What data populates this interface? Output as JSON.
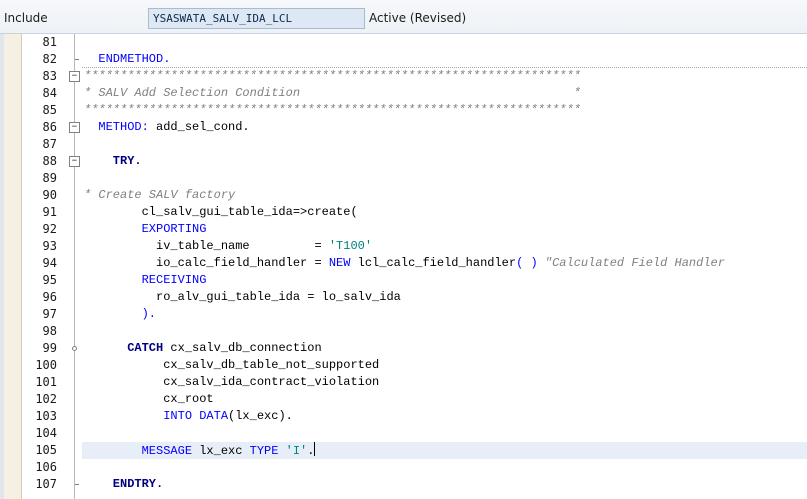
{
  "header": {
    "include_label": "Include",
    "program_name": "YSASWATA_SALV_IDA_LCL",
    "status": "Active (Revised)"
  },
  "colors": {
    "keyword": "#0000ff",
    "comment": "#808080",
    "string": "#008080",
    "current_line": "#e8eef7"
  },
  "lines": [
    {
      "num": "81",
      "marker": "",
      "tokens": []
    },
    {
      "num": "82",
      "marker": "tick",
      "tokens": [
        {
          "t": "  ENDMETHOD.",
          "c": "kw"
        }
      ]
    },
    {
      "num": "83",
      "marker": "fold",
      "tokens": [
        {
          "t": "*********************************************************************",
          "c": "cm"
        }
      ]
    },
    {
      "num": "84",
      "marker": "",
      "tokens": [
        {
          "t": "* SALV Add Selection Condition                                      *",
          "c": "cm"
        }
      ]
    },
    {
      "num": "85",
      "marker": "",
      "tokens": [
        {
          "t": "*********************************************************************",
          "c": "cm"
        }
      ]
    },
    {
      "num": "86",
      "marker": "fold",
      "tokens": [
        {
          "t": "  METHOD:",
          "c": "kw"
        },
        {
          "t": " add_sel_cond.",
          "c": "plain"
        }
      ]
    },
    {
      "num": "87",
      "marker": "",
      "tokens": []
    },
    {
      "num": "88",
      "marker": "fold",
      "tokens": [
        {
          "t": "    TRY.",
          "c": "kwb"
        }
      ]
    },
    {
      "num": "89",
      "marker": "",
      "tokens": []
    },
    {
      "num": "90",
      "marker": "",
      "tokens": [
        {
          "t": "* Create SALV factory",
          "c": "cm"
        }
      ]
    },
    {
      "num": "91",
      "marker": "",
      "tokens": [
        {
          "t": "        cl_salv_gui_table_ida=>create(",
          "c": "plain"
        }
      ]
    },
    {
      "num": "92",
      "marker": "",
      "tokens": [
        {
          "t": "        EXPORTING",
          "c": "kw"
        }
      ]
    },
    {
      "num": "93",
      "marker": "",
      "tokens": [
        {
          "t": "          iv_table_name         = ",
          "c": "plain"
        },
        {
          "t": "'T100'",
          "c": "str"
        }
      ]
    },
    {
      "num": "94",
      "marker": "",
      "tokens": [
        {
          "t": "          io_calc_field_handler = ",
          "c": "plain"
        },
        {
          "t": "NEW",
          "c": "kw"
        },
        {
          "t": " lcl_calc_field_handler",
          "c": "plain"
        },
        {
          "t": "( )",
          "c": "kw"
        },
        {
          "t": " \"Calculated Field Handler",
          "c": "cm"
        }
      ]
    },
    {
      "num": "95",
      "marker": "",
      "tokens": [
        {
          "t": "        RECEIVING",
          "c": "kw"
        }
      ]
    },
    {
      "num": "96",
      "marker": "",
      "tokens": [
        {
          "t": "          ro_alv_gui_table_ida = lo_salv_ida",
          "c": "plain"
        }
      ]
    },
    {
      "num": "97",
      "marker": "",
      "tokens": [
        {
          "t": "        ).",
          "c": "kw"
        }
      ]
    },
    {
      "num": "98",
      "marker": "",
      "tokens": []
    },
    {
      "num": "99",
      "marker": "dot",
      "tokens": [
        {
          "t": "      CATCH",
          "c": "kwb"
        },
        {
          "t": " cx_salv_db_connection",
          "c": "plain"
        }
      ]
    },
    {
      "num": "100",
      "marker": "",
      "tokens": [
        {
          "t": "           cx_salv_db_table_not_supported",
          "c": "plain"
        }
      ]
    },
    {
      "num": "101",
      "marker": "",
      "tokens": [
        {
          "t": "           cx_salv_ida_contract_violation",
          "c": "plain"
        }
      ]
    },
    {
      "num": "102",
      "marker": "",
      "tokens": [
        {
          "t": "           cx_root",
          "c": "plain"
        }
      ]
    },
    {
      "num": "103",
      "marker": "",
      "tokens": [
        {
          "t": "           INTO DATA",
          "c": "kw"
        },
        {
          "t": "(lx_exc).",
          "c": "plain"
        }
      ]
    },
    {
      "num": "104",
      "marker": "",
      "tokens": []
    },
    {
      "num": "105",
      "marker": "",
      "tokens": [
        {
          "t": "        MESSAGE",
          "c": "kw"
        },
        {
          "t": " lx_exc ",
          "c": "plain"
        },
        {
          "t": "TYPE",
          "c": "kw"
        },
        {
          "t": " ",
          "c": "plain"
        },
        {
          "t": "'I'",
          "c": "str"
        },
        {
          "t": ".",
          "c": "plain"
        }
      ]
    },
    {
      "num": "106",
      "marker": "",
      "tokens": []
    },
    {
      "num": "107",
      "marker": "tick",
      "tokens": [
        {
          "t": "    ENDTRY.",
          "c": "kwb"
        }
      ]
    }
  ]
}
